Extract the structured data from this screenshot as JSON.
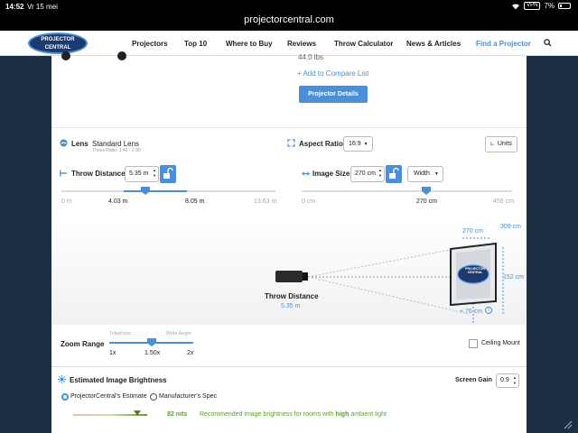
{
  "status_bar": {
    "time": "14:52",
    "date": "Vr 15 mei",
    "vpn": "VPN",
    "battery": "7%"
  },
  "browser": {
    "url": "projectorcentral.com"
  },
  "nav": {
    "logo_line1": "PROJECTOR",
    "logo_line2": "CENTRAL",
    "items": [
      "Projectors",
      "Top 10",
      "Where to Buy",
      "Reviews",
      "Throw Calculator",
      "News & Articles",
      "Find a Projector"
    ],
    "search_icon": "search-icon"
  },
  "product": {
    "weight": "44.0 lbs",
    "compare_link": "+ Add to Compare List",
    "details_button": "Projector Details"
  },
  "lens": {
    "label": "Lens",
    "value": "Standard Lens",
    "throw_ratio": "Throw Ratio: 1.40 - 2.80"
  },
  "aspect_ratio": {
    "label": "Aspect Ratio",
    "value": "16:9"
  },
  "units_button": "Units",
  "throw_distance": {
    "label": "Throw Distance",
    "value": "5.35 m",
    "slider_min": "0 m",
    "slider_low": "4.03 m",
    "slider_high": "8.05 m",
    "slider_max": "13.63 m",
    "position_fraction": 0.392
  },
  "image_size": {
    "label": "Image Size",
    "value": "270 cm",
    "dimension": "Width",
    "slider_min": "0 cm",
    "slider_current": "270 cm",
    "slider_max": "456 cm",
    "position_fraction": 0.592
  },
  "diagram": {
    "throw_label": "Throw Distance",
    "throw_value": "5.35 m",
    "screen_width": "270 cm",
    "screen_diagonal": "309 cm",
    "screen_height": "152 cm",
    "offset": "+ 76 cm",
    "screen_logo_line1": "PROJECTOR",
    "screen_logo_line2": "CENTRAL"
  },
  "zoom": {
    "label": "Zoom Range",
    "telephoto": "Telephoto",
    "wide_angle": "Wide Angle",
    "min": "1x",
    "current": "1.50x",
    "max": "2x",
    "position_fraction": 0.5
  },
  "ceiling_mount": {
    "label": "Ceiling Mount",
    "checked": false
  },
  "brightness": {
    "title": "Estimated Image Brightness",
    "screen_gain_label": "Screen Gain",
    "screen_gain_value": "0.9",
    "option1": "ProjectorCentral's Estimate",
    "option2": "Manufacturer's Spec",
    "nits": "82 nits",
    "recommendation_prefix": "Recommended image brightness for rooms with",
    "recommendation_level": "high",
    "recommendation_suffix": "ambient light"
  },
  "colors": {
    "accent": "#4a8fd8",
    "navy": "#1d2f45",
    "green": "#5aa02c"
  }
}
